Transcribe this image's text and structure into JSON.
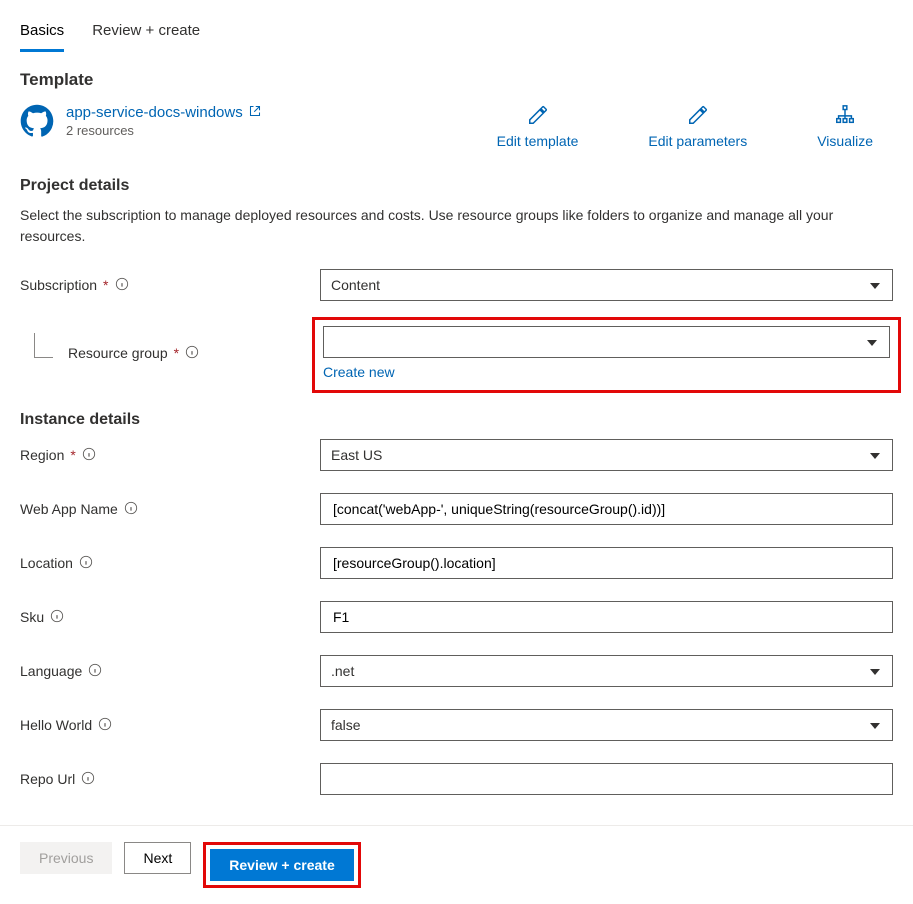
{
  "tabs": {
    "basics": "Basics",
    "review": "Review + create"
  },
  "template": {
    "heading": "Template",
    "name": "app-service-docs-windows",
    "resources": "2 resources"
  },
  "actions": {
    "edit_template": "Edit template",
    "edit_parameters": "Edit parameters",
    "visualize": "Visualize"
  },
  "project_details": {
    "heading": "Project details",
    "description": "Select the subscription to manage deployed resources and costs. Use resource groups like folders to organize and manage all your resources.",
    "subscription_label": "Subscription",
    "subscription_value": "Content",
    "resource_group_label": "Resource group",
    "resource_group_value": "",
    "create_new": "Create new"
  },
  "instance_details": {
    "heading": "Instance details",
    "region_label": "Region",
    "region_value": "East US",
    "webapp_label": "Web App Name",
    "webapp_value": "[concat('webApp-', uniqueString(resourceGroup().id))]",
    "location_label": "Location",
    "location_value": "[resourceGroup().location]",
    "sku_label": "Sku",
    "sku_value": "F1",
    "language_label": "Language",
    "language_value": ".net",
    "hello_label": "Hello World",
    "hello_value": "false",
    "repo_label": "Repo Url",
    "repo_value": ""
  },
  "footer": {
    "previous": "Previous",
    "next": "Next",
    "review_create": "Review + create"
  }
}
